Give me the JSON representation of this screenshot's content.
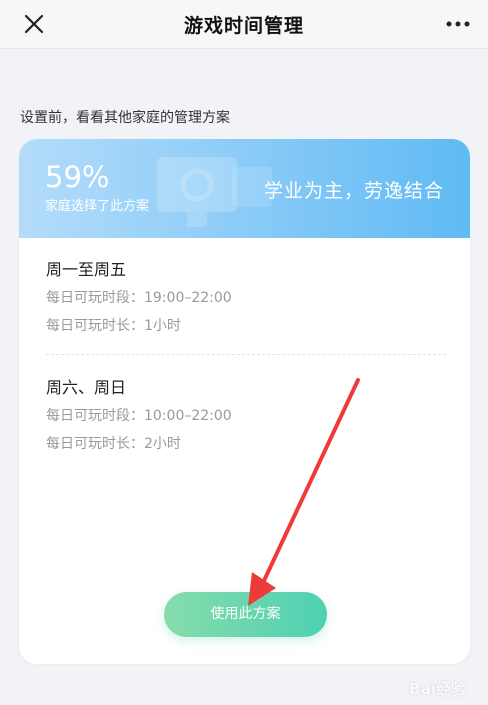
{
  "navbar": {
    "title": "游戏时间管理",
    "close_icon": "close-icon",
    "more_icon": "more-dots-icon"
  },
  "intro_text": "设置前，看看其他家庭的管理方案",
  "plan": {
    "percent": "59%",
    "percent_caption": "家庭选择了此方案",
    "slogan": "学业为主，劳逸结合",
    "weekdays": {
      "title": "周一至周五",
      "period_label": "每日可玩时段：19:00–22:00",
      "duration_label": "每日可玩时长：1小时"
    },
    "weekend": {
      "title": "周六、周日",
      "period_label": "每日可玩时段：10:00–22:00",
      "duration_label": "每日可玩时长：2小时"
    },
    "use_button": "使用此方案"
  },
  "annotation": {
    "arrow_color": "#ef3a3a"
  },
  "watermark": "Bai经验",
  "colors": {
    "banner_start": "#b4dcfa",
    "banner_end": "#5fbaf4",
    "button_start": "#86dcab",
    "button_end": "#4fd0b2"
  }
}
